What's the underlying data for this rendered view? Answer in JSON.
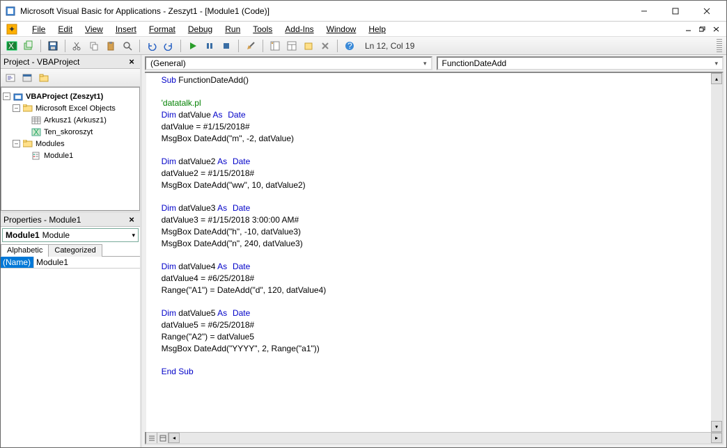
{
  "titlebar": {
    "text": "Microsoft Visual Basic for Applications - Zeszyt1 - [Module1 (Code)]"
  },
  "menu": {
    "items": [
      "File",
      "Edit",
      "View",
      "Insert",
      "Format",
      "Debug",
      "Run",
      "Tools",
      "Add-Ins",
      "Window",
      "Help"
    ]
  },
  "toolbar": {
    "status": "Ln 12, Col 19"
  },
  "project_panel": {
    "title": "Project - VBAProject",
    "tree": {
      "root": "VBAProject (Zeszyt1)",
      "excel_folder": "Microsoft Excel Objects",
      "sheet": "Arkusz1 (Arkusz1)",
      "workbook": "Ten_skoroszyt",
      "modules_folder": "Modules",
      "module": "Module1"
    }
  },
  "props_panel": {
    "title": "Properties - Module1",
    "combo_name": "Module1",
    "combo_type": "Module",
    "tabs": {
      "alpha": "Alphabetic",
      "cat": "Categorized"
    },
    "row_name_label": "(Name)",
    "row_name_value": "Module1"
  },
  "code": {
    "combo_left": "(General)",
    "combo_right": "FunctionDateAdd",
    "tokens": {
      "sub": "Sub",
      "endsub": "End Sub",
      "dim": "Dim",
      "as": "As",
      "date": "Date",
      "fn": " FunctionDateAdd()",
      "cmt": "'datatalk.pl",
      "v1": " datValue ",
      "v1b": "datValue = #1/15/2018#",
      "v1c": "MsgBox DateAdd(\"m\", -2, datValue)",
      "v2": " datValue2 ",
      "v2b": "datValue2 = #1/15/2018#",
      "v2c": "MsgBox DateAdd(\"ww\", 10, datValue2)",
      "v3": " datValue3 ",
      "v3b": "datValue3 = #1/15/2018 3:00:00 AM#",
      "v3c": "MsgBox DateAdd(\"h\", -10, datValue3)",
      "v3d": "MsgBox DateAdd(\"n\", 240, datValue3)",
      "v4": " datValue4 ",
      "v4b": "datValue4 = #6/25/2018#",
      "v4c": "Range(\"A1\") = DateAdd(\"d\", 120, datValue4)",
      "v5": " datValue5 ",
      "v5b": "datValue5 = #6/25/2018#",
      "v5c": "Range(\"A2\") = datValue5",
      "v5d": "MsgBox DateAdd(\"YYYY\", 2, Range(\"a1\"))"
    }
  }
}
